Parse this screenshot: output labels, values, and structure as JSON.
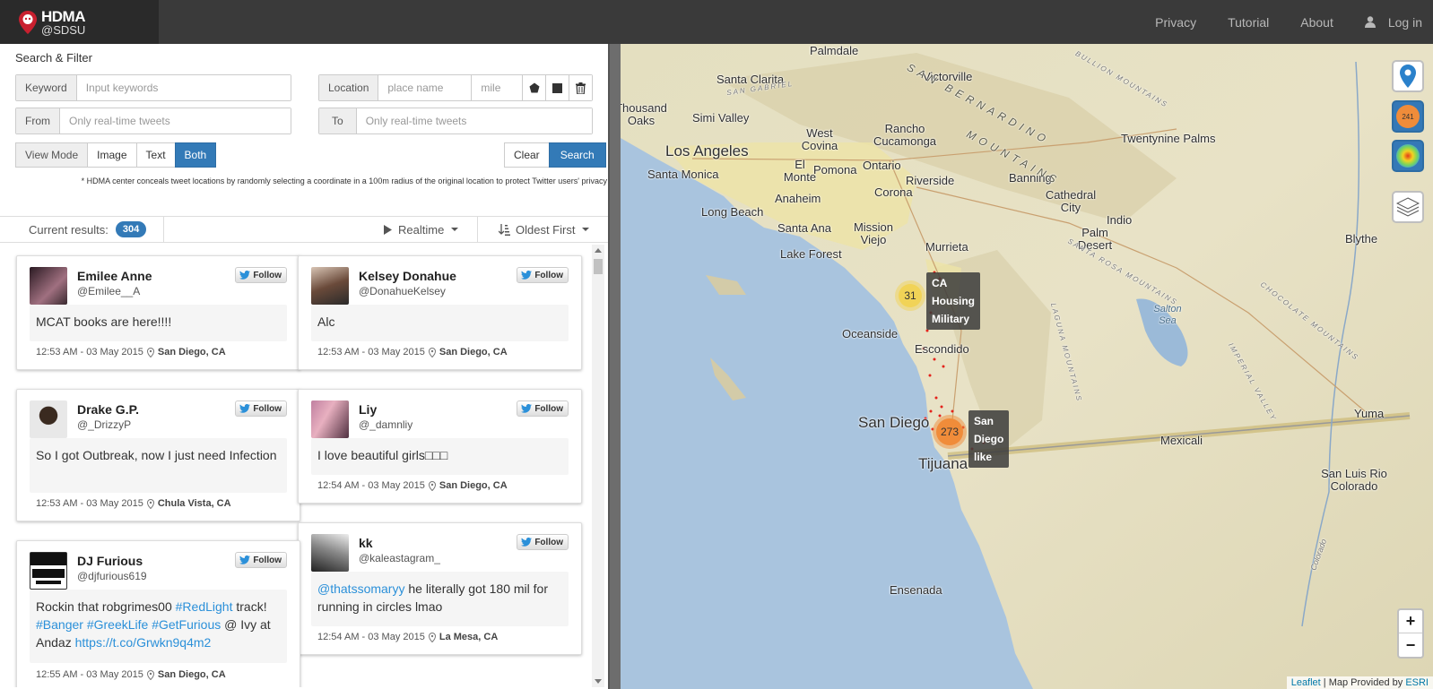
{
  "brand": {
    "title": "HDMA",
    "subtitle": "@SDSU"
  },
  "nav": {
    "privacy": "Privacy",
    "tutorial": "Tutorial",
    "about": "About",
    "login": "Log in"
  },
  "filter": {
    "title": "Search & Filter",
    "keyword_label": "Keyword",
    "keyword_placeholder": "Input keywords",
    "location_label": "Location",
    "place_placeholder": "place name",
    "mile_placeholder": "mile",
    "from_label": "From",
    "from_placeholder": "Only real-time tweets",
    "to_label": "To",
    "to_placeholder": "Only real-time tweets",
    "view_mode_label": "View Mode",
    "view_image": "Image",
    "view_text": "Text",
    "view_both": "Both",
    "clear": "Clear",
    "search": "Search",
    "note": "* HDMA center conceals tweet locations by randomly selecting a coordinate in a 100m radius of the original location to protect Twitter users' privacy"
  },
  "results": {
    "label": "Current results:",
    "count": "304",
    "realtime": "Realtime",
    "order": "Oldest First"
  },
  "follow_label": "Follow",
  "tweets": [
    {
      "name": "Emilee Anne",
      "handle": "@Emilee__A",
      "text": "MCAT books are here!!!!",
      "time": "12:53 AM - 03 May 2015",
      "location": "San Diego, CA"
    },
    {
      "name": "Kelsey Donahue",
      "handle": "@DonahueKelsey",
      "text": "Alc",
      "time": "12:53 AM - 03 May 2015",
      "location": "San Diego, CA"
    },
    {
      "name": "Drake G.P.",
      "handle": "@_DrizzyP",
      "text": "So I got Outbreak, now I just need Infection",
      "time": "12:53 AM - 03 May 2015",
      "location": "Chula Vista, CA"
    },
    {
      "name": "Liy",
      "handle": "@_damnliy",
      "text": "I love beautiful girls□□□",
      "time": "12:54 AM - 03 May 2015",
      "location": "San Diego, CA"
    },
    {
      "name": "kk",
      "handle": "@kaleastagram_",
      "text_link": "@thatssomaryy",
      "text": " he literally got 180 mil for running in circles lmao",
      "time": "12:54 AM - 03 May 2015",
      "location": "La Mesa, CA"
    },
    {
      "name": "DJ Furious",
      "handle": "@djfurious619",
      "text_a": "Rockin that robgrimes00 ",
      "tag1": "#RedLight",
      "text_b": " track! ",
      "tag2": "#Banger",
      "tag3": "#GreekLife",
      "tag4": "#GetFurious",
      "text_c": " @ Ivy at Andaz ",
      "url": "https://t.co/Grwkn9q4m2",
      "time": "12:55 AM - 03 May 2015",
      "location": "San Diego, CA"
    }
  ],
  "map": {
    "labels": {
      "palmdale": "Palmdale",
      "victorville": "Victorville",
      "santa_clarita": "Santa Clarita",
      "thousand_oaks": "Thousand Oaks",
      "simi_valley": "Simi Valley",
      "los_angeles": "Los Angeles",
      "santa_monica": "Santa Monica",
      "west_covina": "West Covina",
      "el_monte": "El Monte",
      "pomona": "Pomona",
      "rancho": "Rancho Cucamonga",
      "ontario": "Ontario",
      "riverside": "Riverside",
      "corona": "Corona",
      "anaheim": "Anaheim",
      "long_beach": "Long Beach",
      "santa_ana": "Santa Ana",
      "mission_viejo": "Mission Viejo",
      "lake_forest": "Lake Forest",
      "murrieta": "Murrieta",
      "oceanside": "Oceanside",
      "escondido": "Escondido",
      "san_diego": "San Diego",
      "tijuana": "Tijuana",
      "banning": "Banning",
      "cathedral_city": "Cathedral City",
      "indio": "Indio",
      "palm_desert": "Palm Desert",
      "twentynine_palms": "Twentynine Palms",
      "blythe": "Blythe",
      "salton_sea": "Salton Sea",
      "mexicali": "Mexicali",
      "yuma": "Yuma",
      "san_luis": "San Luis Rio Colorado",
      "ensenada": "Ensenada",
      "san_bernardino_mtns": "SAN BERNARDINO",
      "mountains": "MOUNTAINS",
      "san_gabriel": "SAN GABRIEL",
      "chocolate": "CHOCOLATE MOUNTAINS",
      "imperial": "IMPERIAL VALLEY",
      "colorado": "Colorado",
      "bullion": "BULLION MOUNTAINS",
      "laguna": "LAGUNA MOUNTAINS",
      "santa_rosa": "SANTA ROSA MOUNTAINS"
    },
    "clusters": [
      {
        "count": "31",
        "keywords": [
          "CA",
          "Housing",
          "Military"
        ],
        "color": "#f1d357"
      },
      {
        "count": "273",
        "keywords": [
          "San",
          "Diego",
          "like"
        ],
        "color": "#f08c3a"
      }
    ],
    "controls": {
      "cluster_badge": "241",
      "zoom_in": "+",
      "zoom_out": "−"
    },
    "attribution": {
      "leaflet": "Leaflet",
      "provider": " | Map Provided by ",
      "esri": "ESRI"
    }
  }
}
